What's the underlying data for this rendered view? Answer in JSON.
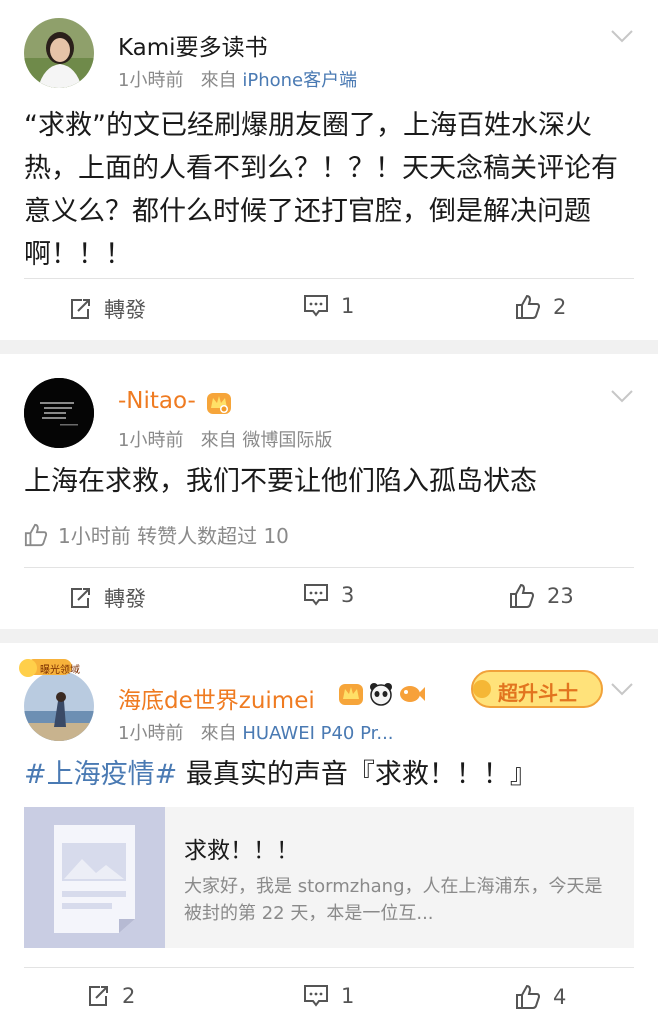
{
  "posts": [
    {
      "username": "Kami要多读书",
      "time": "1小時前",
      "from_label": "來自",
      "source": "iPhone客户端",
      "content": "“求救”的文已经刷爆朋友圈了，上海百姓水深火热，上面的人看不到么？！？！天天念稿关评论有意义么？都什么时候了还打官腔，倒是解决问题啊！！！",
      "actions": {
        "repost": "轉發",
        "comments": "1",
        "likes": "2"
      }
    },
    {
      "username": "-Nitao-",
      "time": "1小時前",
      "from_label": "來自",
      "source": "微博国际版",
      "content": "上海在求救，我们不要让他们陷入孤岛状态",
      "like_info": "1小时前 转赞人数超过 10",
      "actions": {
        "repost": "轉發",
        "comments": "3",
        "likes": "23"
      }
    },
    {
      "username": "海底de世界zuimei",
      "time": "1小時前",
      "from_label": "來自",
      "source": "HUAWEI P40 Pr...",
      "topic": "#上海疫情#",
      "content": "最真实的声音『求救！！！』",
      "badge_text": "超升斗士",
      "avatar_badge": "曝光领域",
      "card": {
        "title": "求救！！！",
        "description": "大家好，我是 stormzhang，人在上海浦东，今天是被封的第 22 天，本是一位互..."
      },
      "actions": {
        "reposts": "2",
        "comments": "1",
        "likes": "4"
      }
    }
  ],
  "colors": {
    "link": "#4a7ab3",
    "orange_name": "#ef7b21",
    "gray": "#8a8a8a"
  }
}
